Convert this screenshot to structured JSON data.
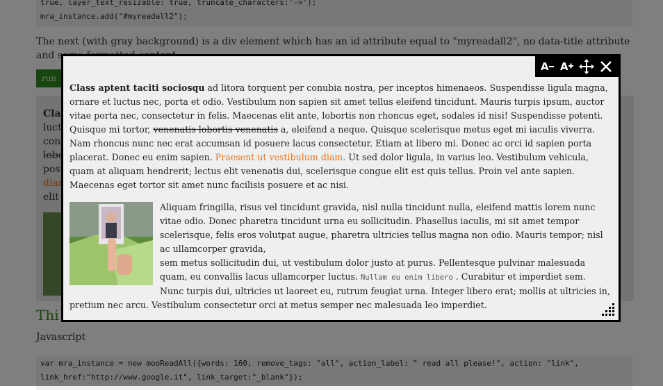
{
  "background": {
    "code_top_line1": "true, layer_text_resizable: true, truncate_characters:'->');",
    "code_top_line2": "mra_instance.add(\"#myreadall2\");",
    "description": "The next (with gray background) is a div element which has an id attribute equal to \"myreadall2\",  no data-title attribute and some formatted content.",
    "run_button": "run",
    "gray_fragments": [
      "Clas",
      "luct",
      "cons",
      "lobo",
      "posu",
      "dian",
      "elit"
    ],
    "heading": "Thi",
    "js_label": "Javascript",
    "code_bottom_line1": "var mra_instance = new mooReadAll({words: 160, remove_tags: \"all\", action_label: \" read all please!\", action: \"link\",",
    "code_bottom_line2": "link_href:\"http://www.google.it\", link_target:\"_blank\"});"
  },
  "modal": {
    "toolbar": {
      "decrease_font": "A-",
      "increase_font": "A+",
      "move_icon": "move-icon",
      "close_icon": "close-icon"
    },
    "p1": {
      "bold": "Class aptent taciti sociosqu",
      "t1": " ad litora torquent per conubia nostra, per inceptos himenaeos. Suspendisse ligula magna, ornare et luctus nec, porta et odio. Vestibulum non sapien sit amet tellus eleifend tincidunt. Mauris turpis ipsum, auctor vitae porta nec, consectetur in felis. Maecenas elit ante, lobortis non rhoncus eget, sodales id nisi! Suspendisse potenti. Quisque mi tortor, ",
      "strike": "venenatis lobortis venenatis",
      "t2": " a, eleifend a neque. Quisque scelerisque metus eget mi iaculis viverra. Nam rhoncus nunc nec erat accumsan id posuere lacus consectetur. Etiam at libero mi. Donec ac orci id sapien porta placerat. Donec eu enim sapien. ",
      "link": "Praesent ut vestibulum diam.",
      "t3": " Ut sed dolor ligula, in varius leo. Vestibulum vehicula, quam at aliquam hendrerit; lectus elit venenatis dui, scelerisque congue elit est quis tellus. Proin vel ante sapien. Maecenas eget tortor sit amet nunc facilisis posuere et ac nisi."
    },
    "p2": {
      "t1": "Aliquam fringilla, risus vel tincidunt gravida, nisl nulla tincidunt nulla, eleifend mattis lorem nunc vitae odio. Donec pharetra tincidunt urna eu sollicitudin. Phasellus iaculis, mi sit amet tempor scelerisque, felis eros volutpat augue, pharetra ultricies tellus magna non odio. Mauris tempor; nisl ac ullamcorper gravida,",
      "t2": "sem metus sollicitudin dui, ut vestibulum dolor justo at purus. Pellentesque pulvinar malesuada quam, eu convallis lacus ullamcorper luctus. ",
      "mono": "Nullam eu enim libero",
      "t3": " . Curabitur et imperdiet sem. Nunc turpis dui, ultricies ut laoreet eu, rutrum feugiat urna. Integer libero erat; mollis at ultricies in, pretium nec arcu. Vestibulum consectetur orci at metus semper nec malesuada leo imperdiet."
    },
    "colors": {
      "link": "#e8731c",
      "toolbar_bg": "#000000",
      "modal_bg": "#efefef"
    }
  }
}
